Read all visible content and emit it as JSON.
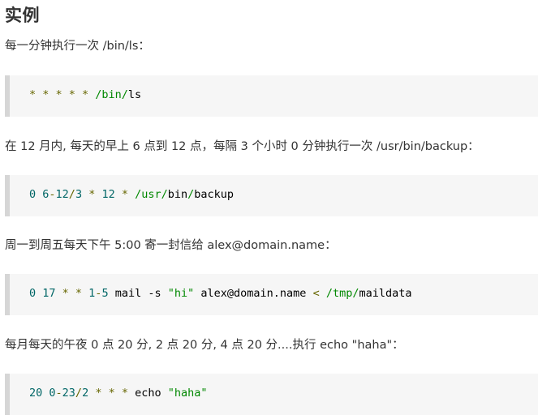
{
  "heading": "实例",
  "examples": [
    {
      "description": "每一分钟执行一次 /bin/ls：",
      "code_tokens": [
        {
          "t": "* * * * * ",
          "c": "op"
        },
        {
          "t": "/bin/",
          "c": "path"
        },
        {
          "t": "ls",
          "c": "pln"
        }
      ]
    },
    {
      "description": "在 12 月内, 每天的早上 6 点到 12 点，每隔 3 个小时 0 分钟执行一次 /usr/bin/backup：",
      "code_tokens": [
        {
          "t": "0 6",
          "c": "num"
        },
        {
          "t": "-",
          "c": "op"
        },
        {
          "t": "12",
          "c": "num"
        },
        {
          "t": "/",
          "c": "op"
        },
        {
          "t": "3",
          "c": "num"
        },
        {
          "t": " * ",
          "c": "op"
        },
        {
          "t": "12",
          "c": "num"
        },
        {
          "t": " * ",
          "c": "op"
        },
        {
          "t": "/usr/",
          "c": "path"
        },
        {
          "t": "bin",
          "c": "pln"
        },
        {
          "t": "/",
          "c": "path"
        },
        {
          "t": "backup",
          "c": "pln"
        }
      ]
    },
    {
      "description": "周一到周五每天下午 5:00 寄一封信给 alex@domain.name：",
      "code_tokens": [
        {
          "t": "0 17",
          "c": "num"
        },
        {
          "t": " * * ",
          "c": "op"
        },
        {
          "t": "1",
          "c": "num"
        },
        {
          "t": "-",
          "c": "op"
        },
        {
          "t": "5",
          "c": "num"
        },
        {
          "t": " mail -s ",
          "c": "pln"
        },
        {
          "t": "\"hi\"",
          "c": "str"
        },
        {
          "t": " alex@domain.name ",
          "c": "pln"
        },
        {
          "t": "<",
          "c": "op"
        },
        {
          "t": " /tmp/",
          "c": "path"
        },
        {
          "t": "maildata",
          "c": "pln"
        }
      ]
    },
    {
      "description": "每月每天的午夜 0 点 20 分, 2 点 20 分, 4 点 20 分....执行 echo \"haha\"：",
      "code_tokens": [
        {
          "t": "20 0",
          "c": "num"
        },
        {
          "t": "-",
          "c": "op"
        },
        {
          "t": "23",
          "c": "num"
        },
        {
          "t": "/",
          "c": "op"
        },
        {
          "t": "2",
          "c": "num"
        },
        {
          "t": " * * * ",
          "c": "op"
        },
        {
          "t": "echo ",
          "c": "pln"
        },
        {
          "t": "\"haha\"",
          "c": "str"
        }
      ]
    }
  ]
}
